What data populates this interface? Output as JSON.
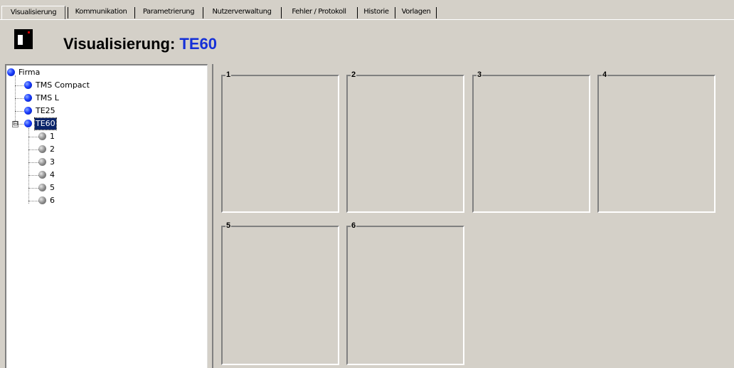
{
  "tabs": [
    {
      "label": "Visualisierung",
      "active": true
    },
    {
      "label": "Kommunikation",
      "active": false
    },
    {
      "label": "Parametrierung",
      "active": false
    },
    {
      "label": "Nutzerverwaltung",
      "active": false
    },
    {
      "label": "Fehler / Protokoll",
      "active": false
    },
    {
      "label": "Historie",
      "active": false
    },
    {
      "label": "Vorlagen",
      "active": false
    }
  ],
  "header": {
    "title_prefix": "Visualisierung: ",
    "device_name": "TE60"
  },
  "tree": {
    "root": {
      "label": "Firma",
      "icon": "blue-ball-icon"
    },
    "devices": [
      {
        "label": "TMS Compact",
        "icon": "blue-ball-icon"
      },
      {
        "label": "TMS L",
        "icon": "blue-ball-icon"
      },
      {
        "label": "TE25",
        "icon": "blue-ball-icon"
      },
      {
        "label": "TE60",
        "icon": "blue-ball-icon",
        "selected": true,
        "expanded": true,
        "expander": "⊟"
      }
    ],
    "channels": [
      {
        "label": "1",
        "icon": "grey-ball-icon"
      },
      {
        "label": "2",
        "icon": "grey-ball-icon"
      },
      {
        "label": "3",
        "icon": "grey-ball-icon"
      },
      {
        "label": "4",
        "icon": "grey-ball-icon"
      },
      {
        "label": "5",
        "icon": "grey-ball-icon"
      },
      {
        "label": "6",
        "icon": "grey-ball-icon"
      }
    ]
  },
  "groups": [
    {
      "label": "1"
    },
    {
      "label": "2"
    },
    {
      "label": "3"
    },
    {
      "label": "4"
    },
    {
      "label": "5"
    },
    {
      "label": "6"
    }
  ],
  "colors": {
    "background": "#d4d0c8",
    "title_accent": "#1530d8",
    "selection": "#0a246a",
    "node_active": "#1a3cff",
    "node_inactive": "#909090"
  }
}
